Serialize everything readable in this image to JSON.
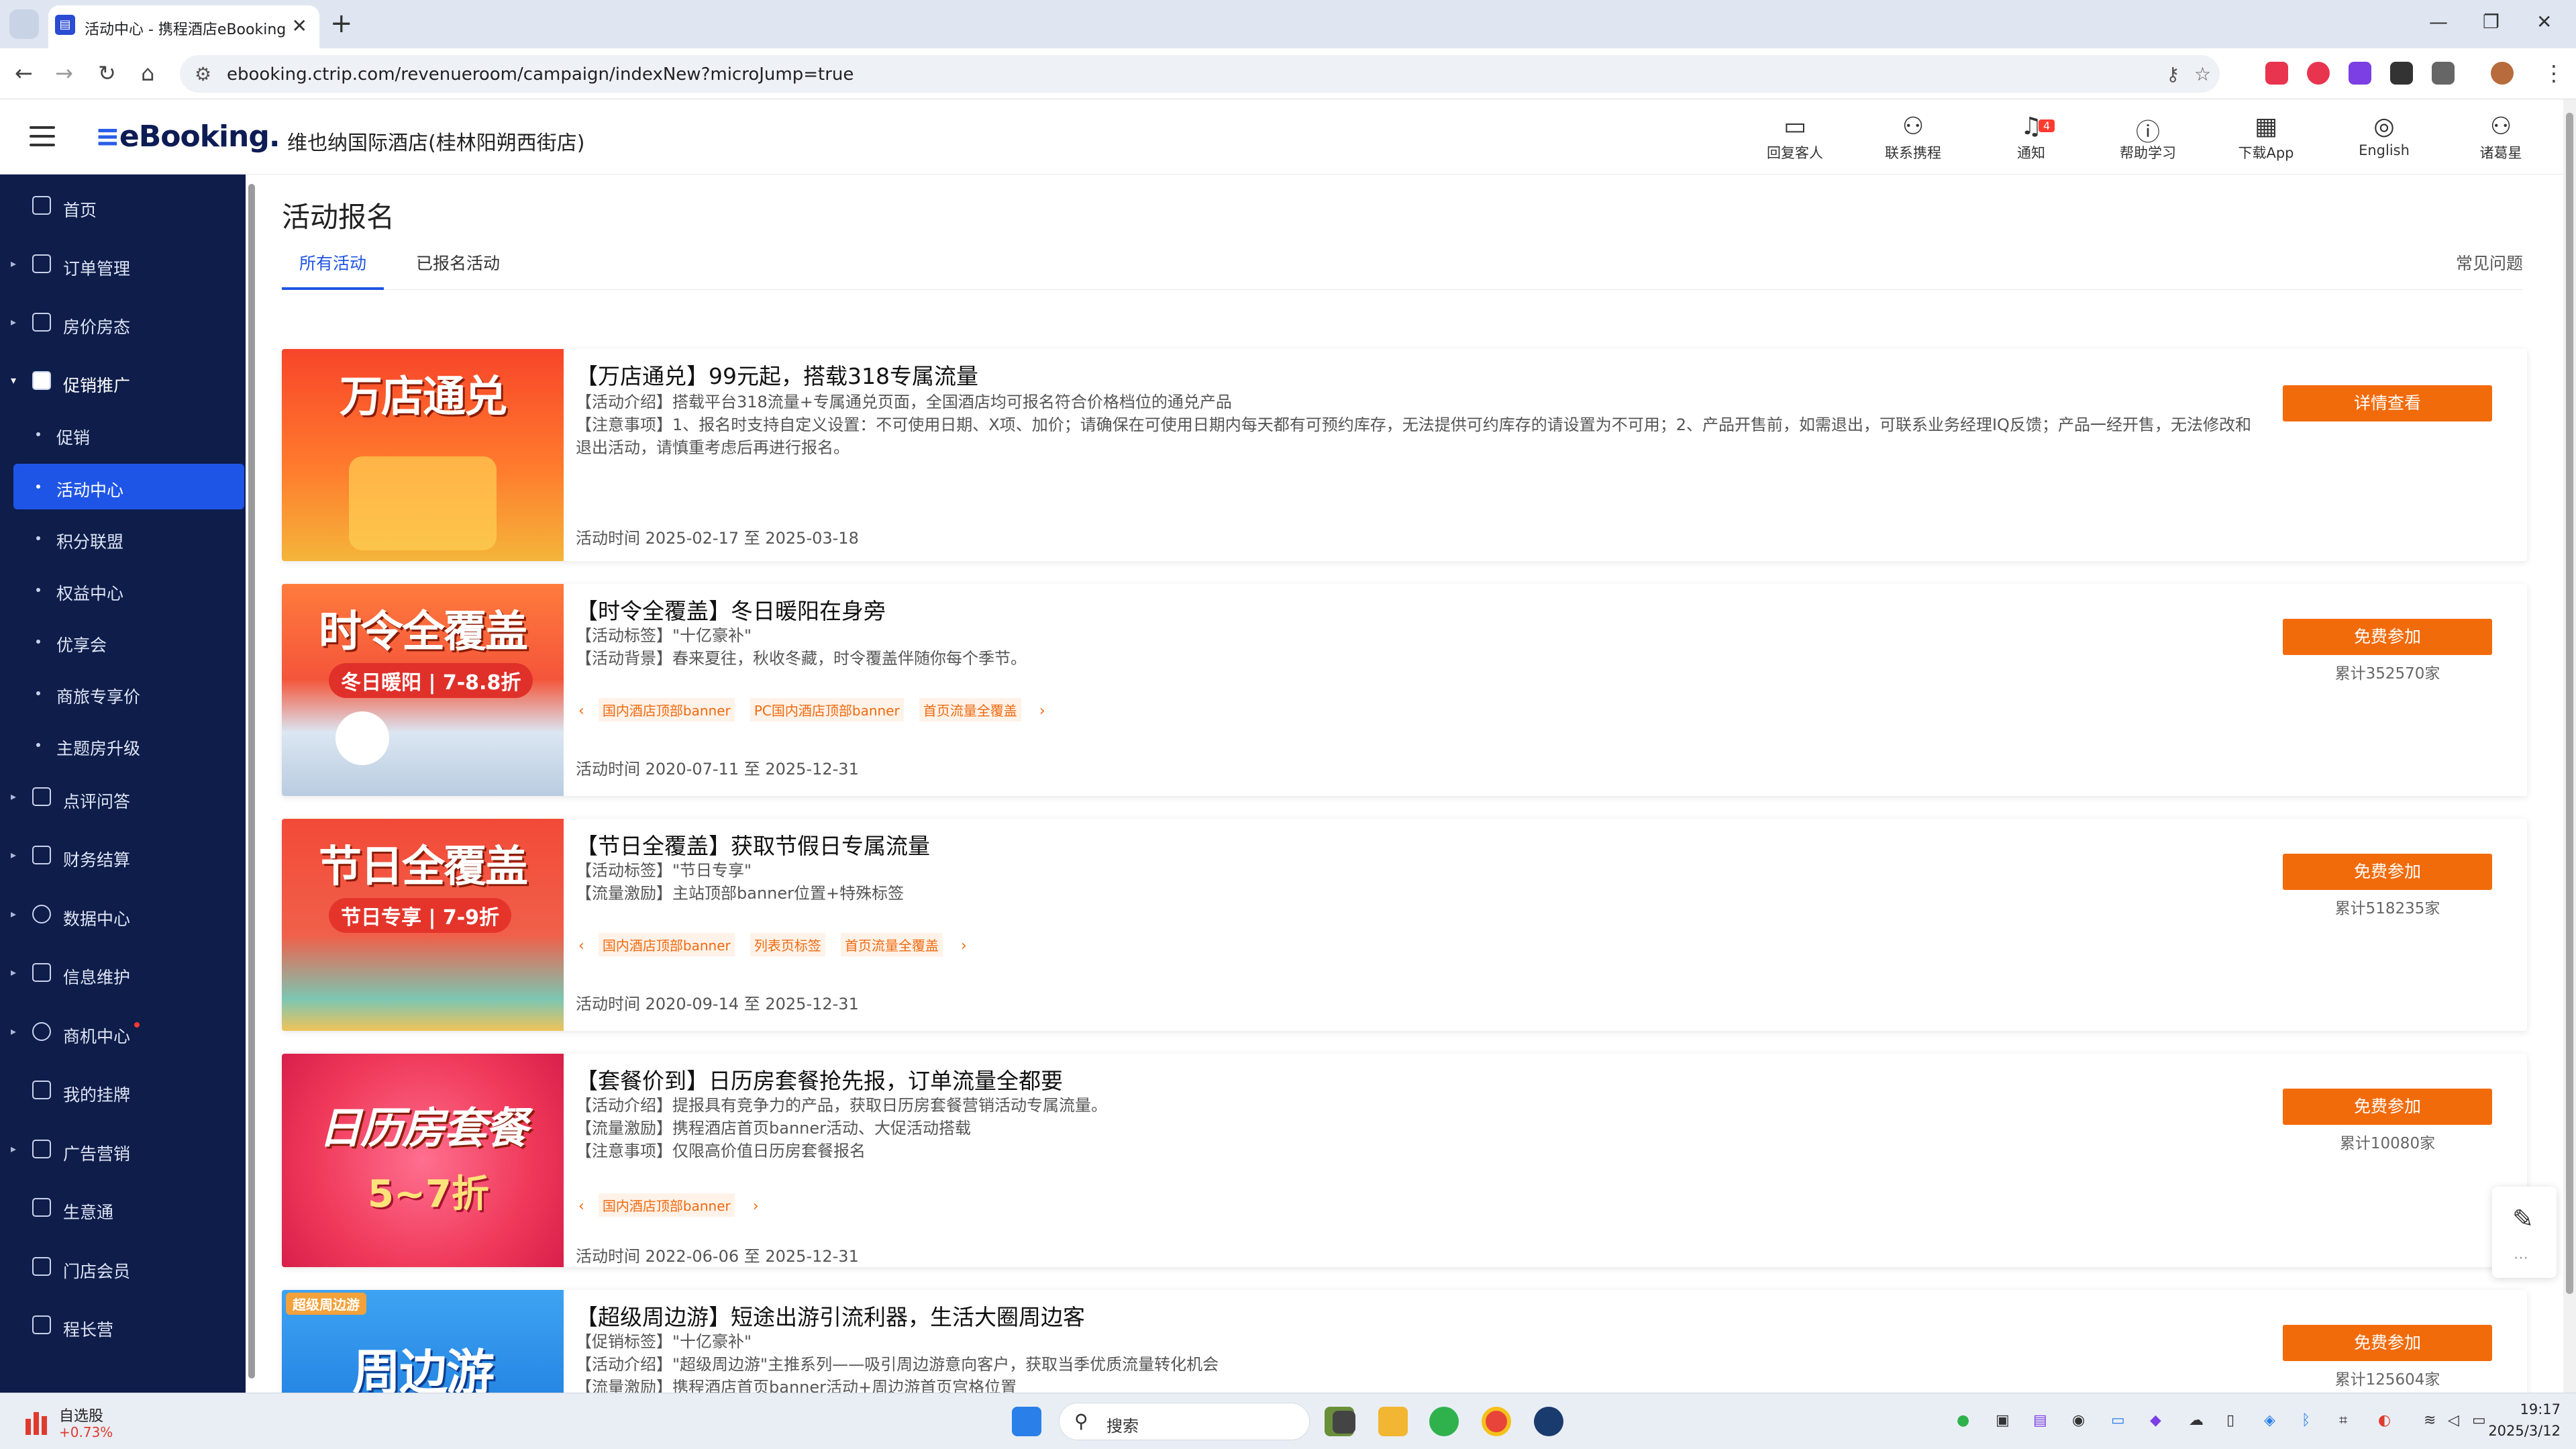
{
  "browser": {
    "tab_title": "活动中心 - 携程酒店eBooking",
    "url": "ebooking.ctrip.com/revenueroom/campaign/indexNew?microJump=true",
    "new_tab": "+",
    "tab_close": "✕",
    "min": "—",
    "max": "❐",
    "close": "✕"
  },
  "header": {
    "logo": "eBooking.",
    "hotel_name": "维也纳国际酒店(桂林阳朔西街店)",
    "nav": [
      {
        "label": "回复客人",
        "icon": "💬"
      },
      {
        "label": "联系携程",
        "icon": "👤"
      },
      {
        "label": "通知",
        "icon": "🔔",
        "badge": "4"
      },
      {
        "label": "帮助学习",
        "icon": "?"
      },
      {
        "label": "下载App",
        "icon": "▦"
      },
      {
        "label": "English",
        "icon": "🌐"
      },
      {
        "label": "诸葛星",
        "icon": "👤"
      }
    ]
  },
  "sidebar": {
    "items": [
      {
        "label": "首页"
      },
      {
        "label": "订单管理"
      },
      {
        "label": "房价房态"
      },
      {
        "label": "促销推广"
      },
      {
        "label": "促销"
      },
      {
        "label": "活动中心"
      },
      {
        "label": "积分联盟"
      },
      {
        "label": "权益中心"
      },
      {
        "label": "优享会"
      },
      {
        "label": "商旅专享价"
      },
      {
        "label": "主题房升级"
      },
      {
        "label": "点评问答"
      },
      {
        "label": "财务结算"
      },
      {
        "label": "数据中心"
      },
      {
        "label": "信息维护"
      },
      {
        "label": "商机中心"
      },
      {
        "label": "我的挂牌"
      },
      {
        "label": "广告营销"
      },
      {
        "label": "生意通"
      },
      {
        "label": "门店会员"
      },
      {
        "label": "程长营"
      }
    ]
  },
  "main": {
    "title": "活动报名",
    "tabs": [
      "所有活动",
      "已报名活动"
    ],
    "faq": "常见问题",
    "cards": [
      {
        "banner_text": "万店通兑",
        "title": "【万店通兑】99元起，搭载318专属流量",
        "lines": [
          "【活动介绍】搭载平台318流量+专属通兑页面，全国酒店均可报名符合价格档位的通兑产品",
          "【注意事项】1、报名时支持自定义设置：不可使用日期、X项、加价；请确保在可使用日期内每天都有可预约库存，无法提供可约库存的请设置为不可用；2、产品开售前，如需退出，可联系业务经理IQ反馈；产品一经开售，无法修改和退出活动，请慎重考虑后再进行报名。"
        ],
        "date": "活动时间 2025-02-17 至 2025-03-18",
        "button": "详情查看"
      },
      {
        "banner_text": "时令全覆盖",
        "banner_sub": "冬日暖阳 | 7-8.8折",
        "title": "【时令全覆盖】冬日暖阳在身旁",
        "lines": [
          "【活动标签】\"十亿豪补\"",
          "【活动背景】春来夏往，秋收冬藏，时令覆盖伴随你每个季节。"
        ],
        "tags": [
          "国内酒店顶部banner",
          "PC国内酒店顶部banner",
          "首页流量全覆盖"
        ],
        "date": "活动时间 2020-07-11 至 2025-12-31",
        "button": "免费参加",
        "count": "累计352570家"
      },
      {
        "banner_text": "节日全覆盖",
        "banner_sub": "节日专享 | 7-9折",
        "title": "【节日全覆盖】获取节假日专属流量",
        "lines": [
          "【活动标签】\"节日专享\"",
          "【流量激励】主站顶部banner位置+特殊标签"
        ],
        "tags": [
          "国内酒店顶部banner",
          "列表页标签",
          "首页流量全覆盖"
        ],
        "date": "活动时间 2020-09-14 至 2025-12-31",
        "button": "免费参加",
        "count": "累计518235家"
      },
      {
        "banner_text": "日历房套餐",
        "banner_sub": "5~7折",
        "title": "【套餐价到】日历房套餐抢先报，订单流量全都要",
        "lines": [
          "【活动介绍】提报具有竞争力的产品，获取日历房套餐营销活动专属流量。",
          "【流量激励】携程酒店首页banner活动、大促活动搭载",
          "【注意事项】仅限高价值日历房套餐报名"
        ],
        "tags": [
          "国内酒店顶部banner"
        ],
        "date": "活动时间 2022-06-06 至 2025-12-31",
        "button": "免费参加",
        "count": "累计10080家"
      },
      {
        "banner_text": "周边游",
        "banner_sub": "超级周边游",
        "title": "【超级周边游】短途出游引流利器，生活大圈周边客",
        "lines": [
          "【促销标签】\"十亿豪补\"",
          "【活动介绍】\"超级周边游\"主推系列——吸引周边游意向客户，获取当季优质流量转化机会",
          "【流量激励】携程酒店首页banner活动+周边游首页宫格位置"
        ],
        "button": "免费参加",
        "count": "累计125604家"
      }
    ]
  },
  "taskbar": {
    "stock_name": "自选股",
    "stock_change": "+0.73%",
    "search_placeholder": "搜索",
    "time": "19:17",
    "date": "2025/3/12"
  }
}
